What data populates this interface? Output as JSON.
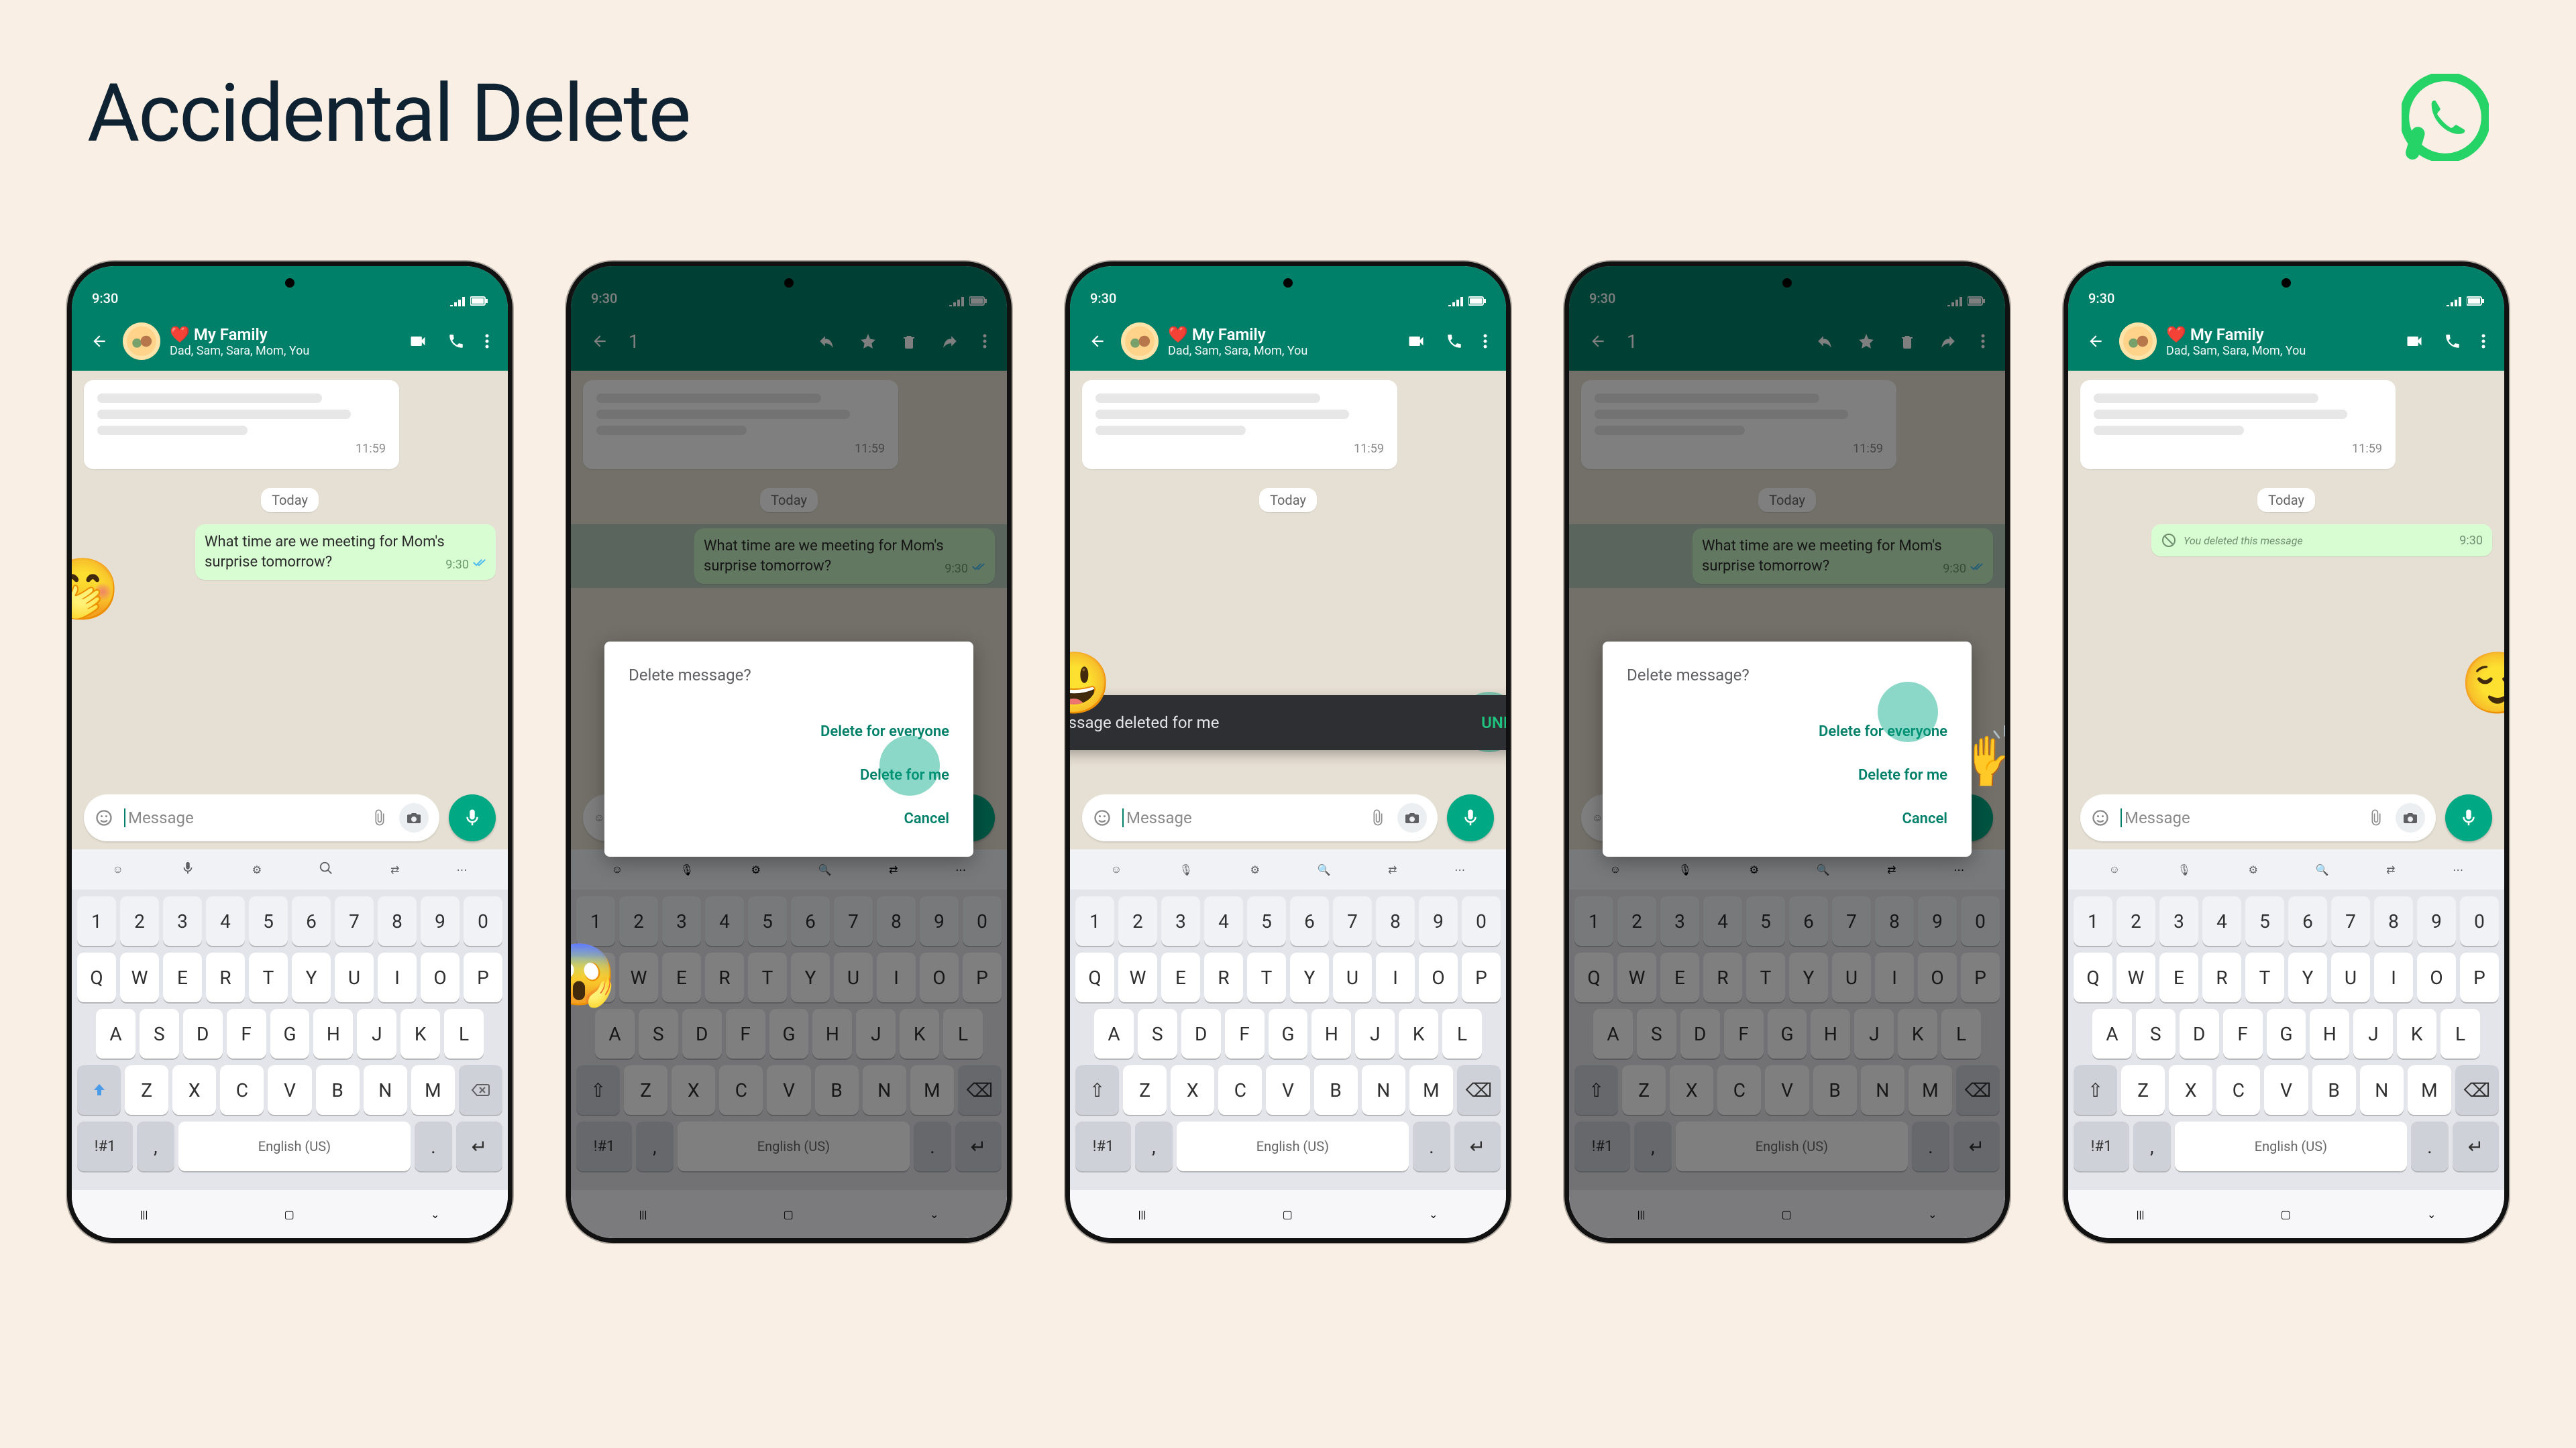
{
  "page": {
    "title": "Accidental Delete"
  },
  "status": {
    "time": "9:30"
  },
  "chat": {
    "title": "My Family",
    "subtitle": "Dad, Sam, Sara, Mom, You",
    "heart": "❤️"
  },
  "body": {
    "incoming_time": "11:59",
    "today": "Today",
    "message": "What time are we meeting for Mom's surprise tomorrow?",
    "message_time": "9:30",
    "deleted_text": "You deleted this message",
    "deleted_time": "9:30"
  },
  "selection": {
    "count": "1"
  },
  "composer": {
    "placeholder": "Message"
  },
  "dialog": {
    "title": "Delete message?",
    "everyone": "Delete for everyone",
    "me": "Delete for me",
    "cancel": "Cancel"
  },
  "snackbar": {
    "text": "Message deleted for me",
    "undo": "UNDO"
  },
  "keyboard": {
    "lang": "English (US)",
    "sym": "!#1",
    "numbers": [
      "1",
      "2",
      "3",
      "4",
      "5",
      "6",
      "7",
      "8",
      "9",
      "0"
    ],
    "row1": [
      "Q",
      "W",
      "E",
      "R",
      "T",
      "Y",
      "U",
      "I",
      "O",
      "P"
    ],
    "row2": [
      "A",
      "S",
      "D",
      "F",
      "G",
      "H",
      "J",
      "K",
      "L"
    ],
    "row3": [
      "Z",
      "X",
      "C",
      "V",
      "B",
      "N",
      "M"
    ]
  },
  "emojis": {
    "hand_over_mouth": "🤭",
    "scream": "😱",
    "grin": "😃",
    "raising_hands": "🙌",
    "relieved": "😌"
  }
}
